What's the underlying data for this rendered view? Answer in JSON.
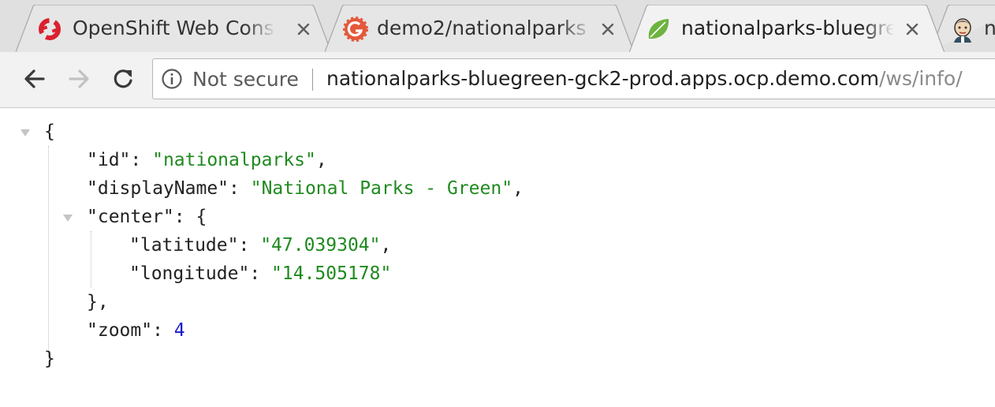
{
  "tabs": [
    {
      "title": "OpenShift Web Console",
      "icon": "openshift-icon",
      "active": false
    },
    {
      "title": "demo2/nationalparks",
      "icon": "gogs-icon",
      "active": false
    },
    {
      "title": "nationalparks-bluegreen",
      "icon": "spring-leaf-icon",
      "active": true
    },
    {
      "title": "n",
      "icon": "jenkins-icon",
      "active": false
    }
  ],
  "toolbar": {
    "security_label": "Not secure",
    "url_host": "nationalparks-bluegreen-gck2-prod.apps.ocp.demo.com",
    "url_path": "/ws/info/"
  },
  "json": {
    "open_brace": "{",
    "close_brace": "}",
    "id_key": "\"id\"",
    "id_value": "\"nationalparks\"",
    "displayName_key": "\"displayName\"",
    "displayName_value": "\"National Parks - Green\"",
    "center_key": "\"center\"",
    "latitude_key": "\"latitude\"",
    "latitude_value": "\"47.039304\"",
    "longitude_key": "\"longitude\"",
    "longitude_value": "\"14.505178\"",
    "zoom_key": "\"zoom\"",
    "zoom_value": "4"
  },
  "colors": {
    "string": "#1f8a1f",
    "number": "#1a1acc",
    "tabstrip": "#e0e0e0",
    "toolbar": "#f2f2f2"
  }
}
